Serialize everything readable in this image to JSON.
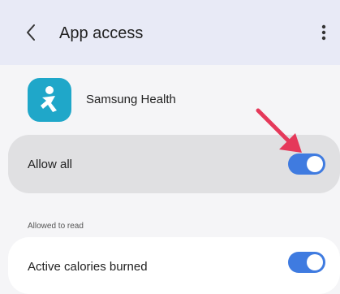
{
  "header": {
    "title": "App access",
    "back_icon": "back-arrow-icon",
    "menu_icon": "more-vertical-icon",
    "background": "#e8eaf6"
  },
  "app": {
    "name": "Samsung Health",
    "icon": "samsung-health-icon",
    "icon_color": "#1fa7c9"
  },
  "allow_all": {
    "label": "Allow all",
    "enabled": true
  },
  "allowed_to_read": {
    "header": "Allowed to read",
    "items": [
      {
        "label": "Active calories burned",
        "enabled": true
      }
    ]
  },
  "colors": {
    "toggle_on": "#3f7be0",
    "pointer_arrow": "#e5395a"
  }
}
